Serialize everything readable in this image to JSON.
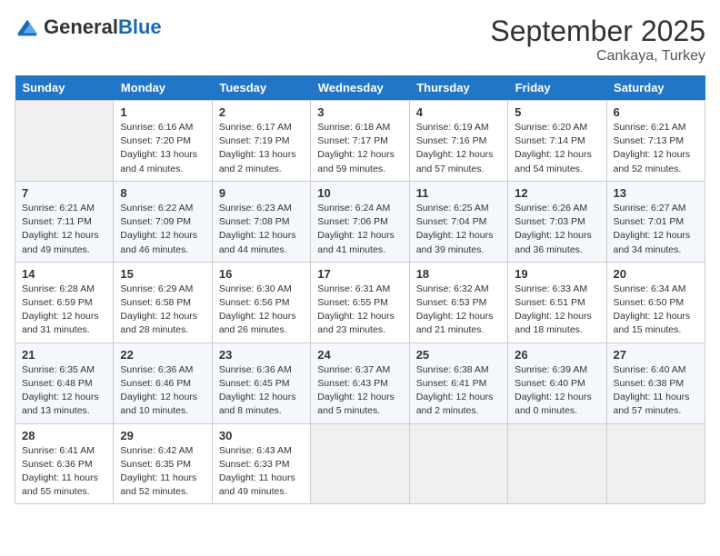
{
  "header": {
    "logo_general": "General",
    "logo_blue": "Blue",
    "month": "September 2025",
    "location": "Cankaya, Turkey"
  },
  "days_of_week": [
    "Sunday",
    "Monday",
    "Tuesday",
    "Wednesday",
    "Thursday",
    "Friday",
    "Saturday"
  ],
  "weeks": [
    [
      {
        "day": "",
        "sunrise": "",
        "sunset": "",
        "daylight": ""
      },
      {
        "day": "1",
        "sunrise": "Sunrise: 6:16 AM",
        "sunset": "Sunset: 7:20 PM",
        "daylight": "Daylight: 13 hours and 4 minutes."
      },
      {
        "day": "2",
        "sunrise": "Sunrise: 6:17 AM",
        "sunset": "Sunset: 7:19 PM",
        "daylight": "Daylight: 13 hours and 2 minutes."
      },
      {
        "day": "3",
        "sunrise": "Sunrise: 6:18 AM",
        "sunset": "Sunset: 7:17 PM",
        "daylight": "Daylight: 12 hours and 59 minutes."
      },
      {
        "day": "4",
        "sunrise": "Sunrise: 6:19 AM",
        "sunset": "Sunset: 7:16 PM",
        "daylight": "Daylight: 12 hours and 57 minutes."
      },
      {
        "day": "5",
        "sunrise": "Sunrise: 6:20 AM",
        "sunset": "Sunset: 7:14 PM",
        "daylight": "Daylight: 12 hours and 54 minutes."
      },
      {
        "day": "6",
        "sunrise": "Sunrise: 6:21 AM",
        "sunset": "Sunset: 7:13 PM",
        "daylight": "Daylight: 12 hours and 52 minutes."
      }
    ],
    [
      {
        "day": "7",
        "sunrise": "Sunrise: 6:21 AM",
        "sunset": "Sunset: 7:11 PM",
        "daylight": "Daylight: 12 hours and 49 minutes."
      },
      {
        "day": "8",
        "sunrise": "Sunrise: 6:22 AM",
        "sunset": "Sunset: 7:09 PM",
        "daylight": "Daylight: 12 hours and 46 minutes."
      },
      {
        "day": "9",
        "sunrise": "Sunrise: 6:23 AM",
        "sunset": "Sunset: 7:08 PM",
        "daylight": "Daylight: 12 hours and 44 minutes."
      },
      {
        "day": "10",
        "sunrise": "Sunrise: 6:24 AM",
        "sunset": "Sunset: 7:06 PM",
        "daylight": "Daylight: 12 hours and 41 minutes."
      },
      {
        "day": "11",
        "sunrise": "Sunrise: 6:25 AM",
        "sunset": "Sunset: 7:04 PM",
        "daylight": "Daylight: 12 hours and 39 minutes."
      },
      {
        "day": "12",
        "sunrise": "Sunrise: 6:26 AM",
        "sunset": "Sunset: 7:03 PM",
        "daylight": "Daylight: 12 hours and 36 minutes."
      },
      {
        "day": "13",
        "sunrise": "Sunrise: 6:27 AM",
        "sunset": "Sunset: 7:01 PM",
        "daylight": "Daylight: 12 hours and 34 minutes."
      }
    ],
    [
      {
        "day": "14",
        "sunrise": "Sunrise: 6:28 AM",
        "sunset": "Sunset: 6:59 PM",
        "daylight": "Daylight: 12 hours and 31 minutes."
      },
      {
        "day": "15",
        "sunrise": "Sunrise: 6:29 AM",
        "sunset": "Sunset: 6:58 PM",
        "daylight": "Daylight: 12 hours and 28 minutes."
      },
      {
        "day": "16",
        "sunrise": "Sunrise: 6:30 AM",
        "sunset": "Sunset: 6:56 PM",
        "daylight": "Daylight: 12 hours and 26 minutes."
      },
      {
        "day": "17",
        "sunrise": "Sunrise: 6:31 AM",
        "sunset": "Sunset: 6:55 PM",
        "daylight": "Daylight: 12 hours and 23 minutes."
      },
      {
        "day": "18",
        "sunrise": "Sunrise: 6:32 AM",
        "sunset": "Sunset: 6:53 PM",
        "daylight": "Daylight: 12 hours and 21 minutes."
      },
      {
        "day": "19",
        "sunrise": "Sunrise: 6:33 AM",
        "sunset": "Sunset: 6:51 PM",
        "daylight": "Daylight: 12 hours and 18 minutes."
      },
      {
        "day": "20",
        "sunrise": "Sunrise: 6:34 AM",
        "sunset": "Sunset: 6:50 PM",
        "daylight": "Daylight: 12 hours and 15 minutes."
      }
    ],
    [
      {
        "day": "21",
        "sunrise": "Sunrise: 6:35 AM",
        "sunset": "Sunset: 6:48 PM",
        "daylight": "Daylight: 12 hours and 13 minutes."
      },
      {
        "day": "22",
        "sunrise": "Sunrise: 6:36 AM",
        "sunset": "Sunset: 6:46 PM",
        "daylight": "Daylight: 12 hours and 10 minutes."
      },
      {
        "day": "23",
        "sunrise": "Sunrise: 6:36 AM",
        "sunset": "Sunset: 6:45 PM",
        "daylight": "Daylight: 12 hours and 8 minutes."
      },
      {
        "day": "24",
        "sunrise": "Sunrise: 6:37 AM",
        "sunset": "Sunset: 6:43 PM",
        "daylight": "Daylight: 12 hours and 5 minutes."
      },
      {
        "day": "25",
        "sunrise": "Sunrise: 6:38 AM",
        "sunset": "Sunset: 6:41 PM",
        "daylight": "Daylight: 12 hours and 2 minutes."
      },
      {
        "day": "26",
        "sunrise": "Sunrise: 6:39 AM",
        "sunset": "Sunset: 6:40 PM",
        "daylight": "Daylight: 12 hours and 0 minutes."
      },
      {
        "day": "27",
        "sunrise": "Sunrise: 6:40 AM",
        "sunset": "Sunset: 6:38 PM",
        "daylight": "Daylight: 11 hours and 57 minutes."
      }
    ],
    [
      {
        "day": "28",
        "sunrise": "Sunrise: 6:41 AM",
        "sunset": "Sunset: 6:36 PM",
        "daylight": "Daylight: 11 hours and 55 minutes."
      },
      {
        "day": "29",
        "sunrise": "Sunrise: 6:42 AM",
        "sunset": "Sunset: 6:35 PM",
        "daylight": "Daylight: 11 hours and 52 minutes."
      },
      {
        "day": "30",
        "sunrise": "Sunrise: 6:43 AM",
        "sunset": "Sunset: 6:33 PM",
        "daylight": "Daylight: 11 hours and 49 minutes."
      },
      {
        "day": "",
        "sunrise": "",
        "sunset": "",
        "daylight": ""
      },
      {
        "day": "",
        "sunrise": "",
        "sunset": "",
        "daylight": ""
      },
      {
        "day": "",
        "sunrise": "",
        "sunset": "",
        "daylight": ""
      },
      {
        "day": "",
        "sunrise": "",
        "sunset": "",
        "daylight": ""
      }
    ]
  ]
}
